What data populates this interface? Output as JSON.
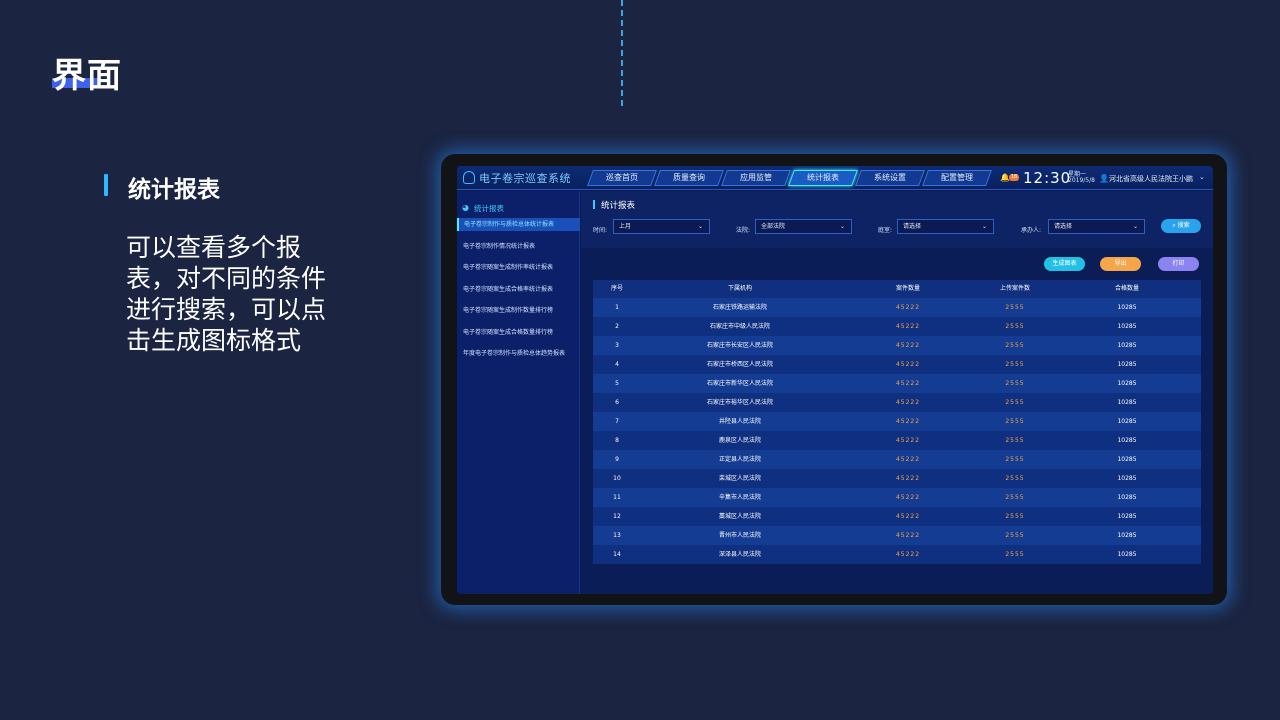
{
  "slide": {
    "title": "界面",
    "section_title": "统计报表",
    "description": "可以查看多个报表，对不同的条件进行搜索，可以点击生成图标格式"
  },
  "app": {
    "title": "电子卷宗巡查系统",
    "nav": [
      "巡查首页",
      "质量查询",
      "应用监管",
      "统计报表",
      "系统设置",
      "配置管理"
    ],
    "active_nav_index": 3,
    "notification_count": "18",
    "time": "12:30",
    "weekday": "星期一",
    "date": "2019/5/8",
    "court": "河北省高级人民法院",
    "user": "王小鹏"
  },
  "sidebar": {
    "header": "统计报表",
    "items": [
      "电子卷宗制作与质检总体统计报表",
      "电子卷宗制作情况统计报表",
      "电子卷宗随案生成制作率统计报表",
      "电子卷宗随案生成合格率统计报表",
      "电子卷宗随案生成制作数量排行榜",
      "电子卷宗随案生成合格数量排行榜",
      "年度电子卷宗制作与质检总体趋势报表"
    ],
    "active_index": 0
  },
  "panel": {
    "title": "统计报表",
    "filters": {
      "time_label": "时间:",
      "time_value": "上月",
      "court_label": "法院:",
      "court_value": "全部法院",
      "tribunal_label": "庭室:",
      "tribunal_value": "请选择",
      "handler_label": "承办人:",
      "handler_value": "请选择",
      "search": "搜索"
    },
    "actions": {
      "generate": "生成图表",
      "export": "导出",
      "print": "打印"
    }
  },
  "table": {
    "headers": [
      "序号",
      "下属机构",
      "案件数量",
      "上传案件数",
      "合格数量"
    ],
    "rows": [
      [
        "1",
        "石家庄铁路运输法院",
        "45222",
        "2555",
        "10285"
      ],
      [
        "2",
        "石家庄市中级人民法院",
        "45222",
        "2555",
        "10285"
      ],
      [
        "3",
        "石家庄市长安区人民法院",
        "45222",
        "2555",
        "10285"
      ],
      [
        "4",
        "石家庄市桥西区人民法院",
        "45222",
        "2555",
        "10285"
      ],
      [
        "5",
        "石家庄市新华区人民法院",
        "45222",
        "2555",
        "10285"
      ],
      [
        "6",
        "石家庄市裕华区人民法院",
        "45222",
        "2555",
        "10285"
      ],
      [
        "7",
        "井陉县人民法院",
        "45222",
        "2555",
        "10285"
      ],
      [
        "8",
        "鹿泉区人民法院",
        "45222",
        "2555",
        "10285"
      ],
      [
        "9",
        "正定县人民法院",
        "45222",
        "2555",
        "10285"
      ],
      [
        "10",
        "栾城区人民法院",
        "45222",
        "2555",
        "10285"
      ],
      [
        "11",
        "辛集市人民法院",
        "45222",
        "2555",
        "10285"
      ],
      [
        "12",
        "藁城区人民法院",
        "45222",
        "2555",
        "10285"
      ],
      [
        "13",
        "晋州市人民法院",
        "45222",
        "2555",
        "10285"
      ],
      [
        "14",
        "深泽县人民法院",
        "45222",
        "2555",
        "10285"
      ]
    ]
  }
}
